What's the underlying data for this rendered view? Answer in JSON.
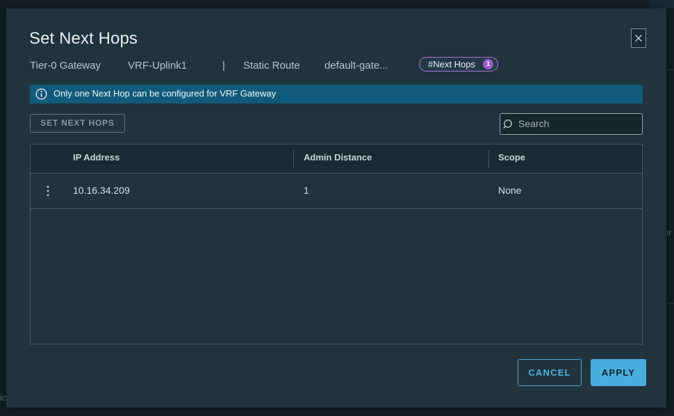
{
  "background": {
    "right_fragment": "or",
    "left_fragment": "ic"
  },
  "modal": {
    "title": "Set Next Hops",
    "breadcrumb": {
      "gateway_type": "Tier-0 Gateway",
      "gateway_name": "VRF-Uplink1",
      "separator": "|",
      "route_type": "Static Route",
      "route_name": "default-gate..."
    },
    "next_hops_pill": {
      "label": "#Next Hops",
      "count": "1"
    },
    "info_banner": {
      "text": "Only one Next Hop can be configured for VRF Gateway"
    },
    "set_next_hops_button": "SET NEXT HOPS",
    "search": {
      "placeholder": "Search",
      "value": ""
    },
    "table": {
      "columns": [
        "IP Address",
        "Admin Distance",
        "Scope"
      ],
      "rows": [
        {
          "ip_address": "10.16.34.209",
          "admin_distance": "1",
          "scope": "None"
        }
      ]
    },
    "cancel_button": "CANCEL",
    "apply_button": "APPLY"
  },
  "colors": {
    "modal_bg": "#21333c",
    "info_banner": "#105a7c",
    "accent": "#49aedf",
    "pill_border": "#a676d4",
    "pill_badge": "#9a5cd0"
  },
  "icons": {
    "close": "close-icon",
    "info": "info-icon",
    "search": "search-icon",
    "row_actions": "vertical-ellipsis-icon"
  }
}
